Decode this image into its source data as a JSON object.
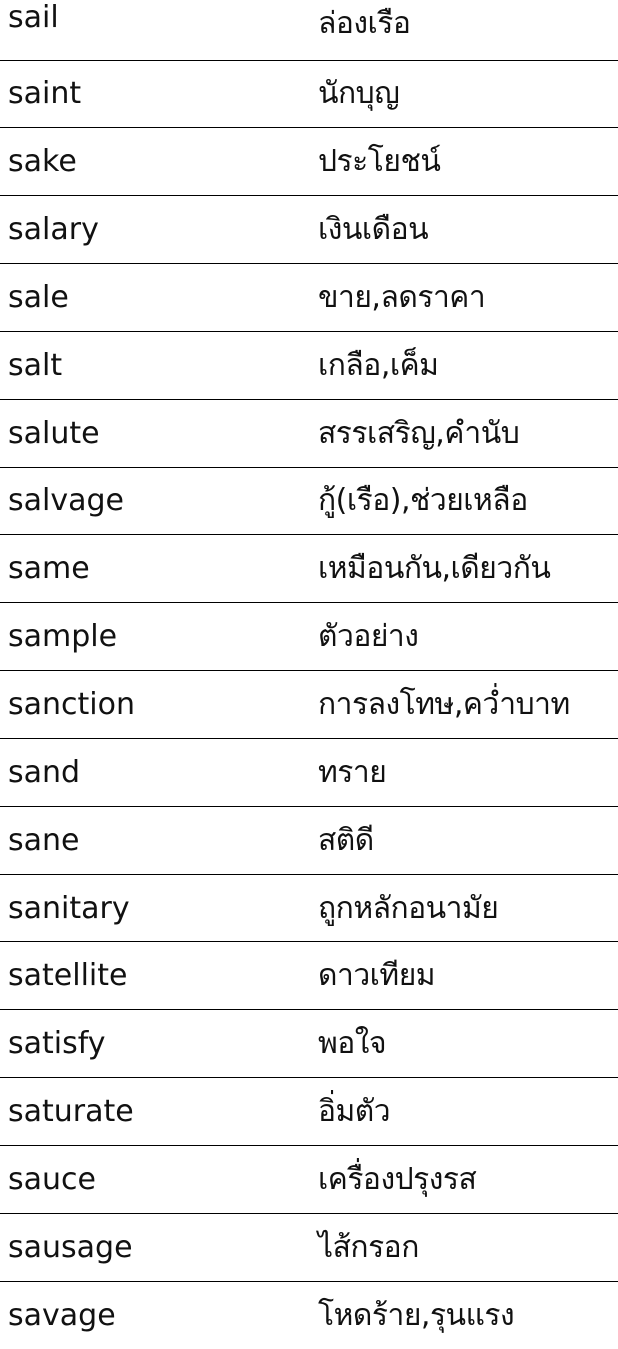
{
  "vocabulary": [
    {
      "english": "sail",
      "thai": "ล่องเรือ"
    },
    {
      "english": "saint",
      "thai": "นักบุญ"
    },
    {
      "english": "sake",
      "thai": "ประโยชน์"
    },
    {
      "english": "salary",
      "thai": "เงินเดือน"
    },
    {
      "english": "sale",
      "thai": "ขาย,ลดราคา"
    },
    {
      "english": "salt",
      "thai": "เกลือ,เค็ม"
    },
    {
      "english": "salute",
      "thai": "สรรเสริญ,คำนับ"
    },
    {
      "english": "salvage",
      "thai": "กู้(เรือ),ช่วยเหลือ"
    },
    {
      "english": "same",
      "thai": "เหมือนกัน,เดียวกัน"
    },
    {
      "english": "sample",
      "thai": "ตัวอย่าง"
    },
    {
      "english": "sanction",
      "thai": "การลงโทษ,คว่ำบาท"
    },
    {
      "english": "sand",
      "thai": "ทราย"
    },
    {
      "english": "sane",
      "thai": "สติดี"
    },
    {
      "english": "sanitary",
      "thai": "ถูกหลักอนามัย"
    },
    {
      "english": "satellite",
      "thai": "ดาวเทียม"
    },
    {
      "english": "satisfy",
      "thai": "พอใจ"
    },
    {
      "english": "saturate",
      "thai": "อิ่มตัว"
    },
    {
      "english": "sauce",
      "thai": "เครื่องปรุงรส"
    },
    {
      "english": "sausage",
      "thai": "ไส้กรอก"
    },
    {
      "english": "savage",
      "thai": "โหดร้าย,รุนแรง"
    }
  ]
}
